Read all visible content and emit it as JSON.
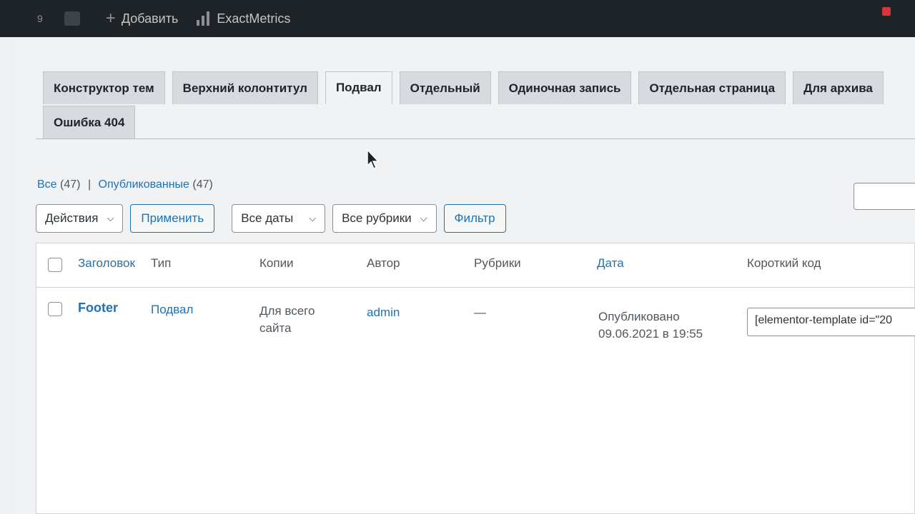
{
  "adminbar": {
    "count": "9",
    "add_label": "Добавить",
    "plugin_label": "ExactMetrics"
  },
  "tabs": [
    {
      "label": "Конструктор тем",
      "active": false
    },
    {
      "label": "Верхний колонтитул",
      "active": false
    },
    {
      "label": "Подвал",
      "active": true
    },
    {
      "label": "Отдельный",
      "active": false
    },
    {
      "label": "Одиночная запись",
      "active": false
    },
    {
      "label": "Отдельная страница",
      "active": false
    },
    {
      "label": "Для архива",
      "active": false
    },
    {
      "label": "Ошибка 404",
      "active": false
    }
  ],
  "views": {
    "all_label": "Все",
    "all_count": "(47)",
    "separator": "|",
    "published_label": "Опубликованные",
    "published_count": "(47)"
  },
  "filters": {
    "bulk_actions": "Действия",
    "apply": "Применить",
    "dates": "Все даты",
    "categories": "Все рубрики",
    "filter": "Фильтр"
  },
  "table": {
    "columns": {
      "title": "Заголовок",
      "type": "Тип",
      "instances": "Копии",
      "author": "Автор",
      "categories": "Рубрики",
      "date": "Дата",
      "shortcode": "Короткий код"
    },
    "rows": [
      {
        "title": "Footer",
        "type": "Подвал",
        "instances_line1": "Для всего",
        "instances_line2": "сайта",
        "author": "admin",
        "categories": "—",
        "date_status": "Опубликовано",
        "date_value": "09.06.2021 в 19:55",
        "shortcode": "[elementor-template id=\"20"
      }
    ]
  },
  "colors": {
    "link": "#2271b1",
    "adminbar": "#1d2327"
  }
}
